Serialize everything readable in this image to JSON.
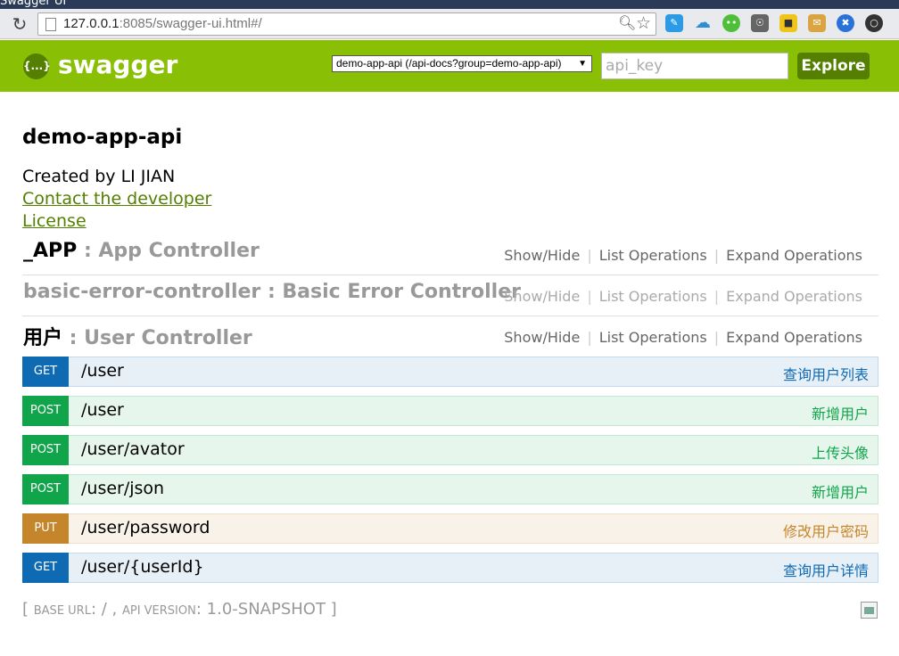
{
  "browser": {
    "tab_title": "Swagger UI",
    "url_host": "127.0.0.1",
    "url_rest": ":8085/swagger-ui.html#/"
  },
  "header": {
    "logo_text": "{...}",
    "title": "swagger",
    "api_select": "demo-app-api (/api-docs?group=demo-app-api)",
    "api_key_placeholder": "api_key",
    "explore_label": "Explore"
  },
  "info": {
    "title": "demo-app-api",
    "created_by": "Created by LI JIAN",
    "contact_link": "Contact the developer",
    "license_link": "License"
  },
  "ops_labels": {
    "show_hide": "Show/Hide",
    "list": "List Operations",
    "expand": "Expand Operations"
  },
  "resources": [
    {
      "name": "_APP",
      "sep": " : ",
      "desc": "App Controller"
    },
    {
      "name": "basic-error-controller",
      "sep": " : ",
      "desc": "Basic Error Controller"
    },
    {
      "name": "用户",
      "sep": " : ",
      "desc": "User Controller"
    }
  ],
  "endpoints": [
    {
      "method": "GET",
      "path": "/user",
      "summary": "查询用户列表"
    },
    {
      "method": "POST",
      "path": "/user",
      "summary": "新增用户"
    },
    {
      "method": "POST",
      "path": "/user/avator",
      "summary": "上传头像"
    },
    {
      "method": "POST",
      "path": "/user/json",
      "summary": "新增用户"
    },
    {
      "method": "PUT",
      "path": "/user/password",
      "summary": "修改用户密码"
    },
    {
      "method": "GET",
      "path": "/user/{userId}",
      "summary": "查询用户详情"
    }
  ],
  "footer": {
    "open": "[ ",
    "base_url_label": "BASE URL",
    "base_url_value": ": / , ",
    "api_version_label": "API VERSION",
    "api_version_value": ": 1.0-SNAPSHOT ]"
  },
  "colors": {
    "header_bg": "#89bf04",
    "button_bg": "#547f00",
    "get": "#0f6ab4",
    "post": "#10a54a",
    "put": "#c5862b"
  }
}
